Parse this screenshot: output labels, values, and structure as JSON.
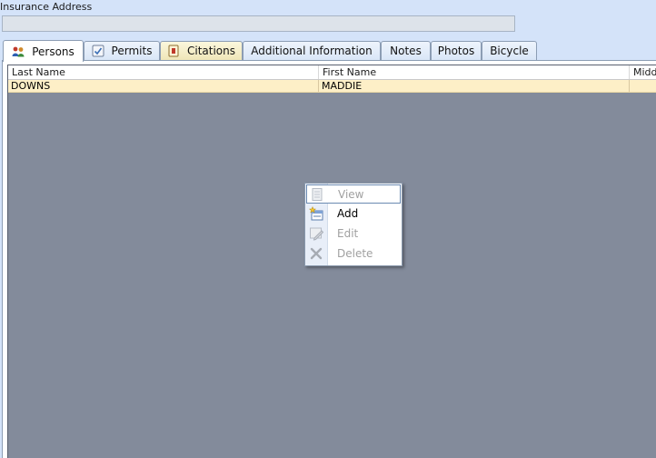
{
  "insurance": {
    "label": "Insurance Address",
    "value": ""
  },
  "tabs": [
    {
      "label": "Persons",
      "icon": "persons-icon"
    },
    {
      "label": "Permits",
      "icon": "permit-check-icon"
    },
    {
      "label": "Citations",
      "icon": "citation-icon"
    },
    {
      "label": "Additional Information"
    },
    {
      "label": "Notes"
    },
    {
      "label": "Photos"
    },
    {
      "label": "Bicycle"
    }
  ],
  "active_tab": "Persons",
  "grid": {
    "columns": [
      "Last Name",
      "First Name",
      "Middle"
    ],
    "rows": [
      {
        "last": "DOWNS",
        "first": "MADDIE",
        "middle": ""
      }
    ]
  },
  "context_menu": {
    "items": [
      {
        "label": "View",
        "enabled": false,
        "icon": "view-document-icon"
      },
      {
        "label": "Add",
        "enabled": true,
        "icon": "add-record-icon"
      },
      {
        "label": "Edit",
        "enabled": false,
        "icon": "edit-icon"
      },
      {
        "label": "Delete",
        "enabled": false,
        "icon": "delete-x-icon"
      }
    ]
  },
  "colors": {
    "window_bg": "#d4e3f9",
    "grid_bg": "#838b9b",
    "selected_row": "#fdefc7",
    "tab_border": "#8c9db4"
  }
}
